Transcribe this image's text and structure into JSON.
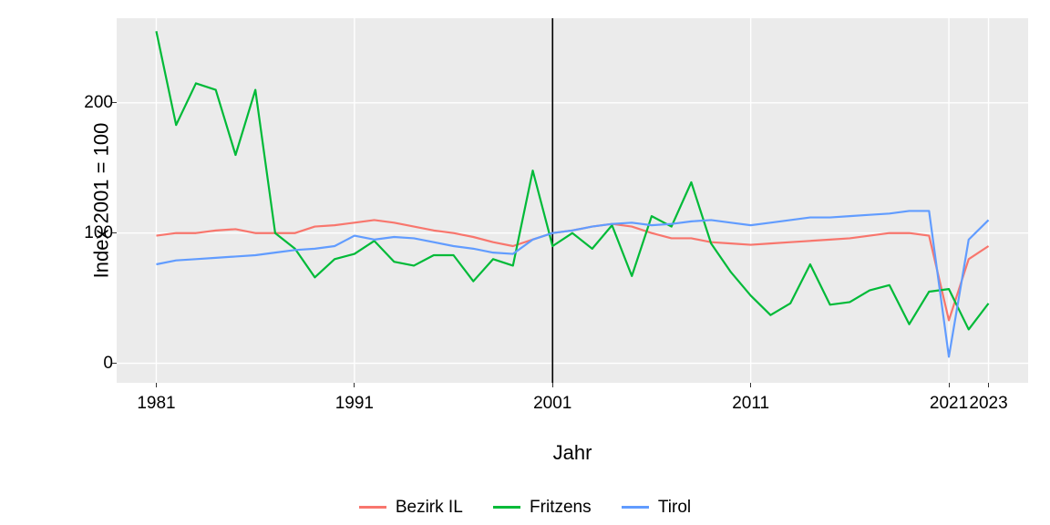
{
  "chart_data": {
    "type": "line",
    "xlabel": "Jahr",
    "ylabel": "Index 2001 = 100",
    "xlim": [
      1979,
      2025
    ],
    "ylim": [
      -15,
      265
    ],
    "x_ticks": [
      1981,
      1991,
      2001,
      2011,
      2021,
      2023
    ],
    "y_ticks": [
      0,
      100,
      200
    ],
    "reference_x": 2001,
    "x": [
      1981,
      1982,
      1983,
      1984,
      1985,
      1986,
      1987,
      1988,
      1989,
      1990,
      1991,
      1992,
      1993,
      1994,
      1995,
      1996,
      1997,
      1998,
      1999,
      2000,
      2001,
      2002,
      2003,
      2004,
      2005,
      2006,
      2007,
      2008,
      2009,
      2010,
      2011,
      2012,
      2013,
      2014,
      2015,
      2016,
      2017,
      2018,
      2019,
      2020,
      2021,
      2022,
      2023
    ],
    "series": [
      {
        "name": "Bezirk IL",
        "color": "#f8766d",
        "values": [
          98,
          100,
          100,
          102,
          103,
          100,
          100,
          100,
          105,
          106,
          108,
          110,
          108,
          105,
          102,
          100,
          97,
          93,
          90,
          95,
          100,
          102,
          105,
          107,
          105,
          100,
          96,
          96,
          93,
          92,
          91,
          92,
          93,
          94,
          95,
          96,
          98,
          100,
          100,
          98,
          33,
          80,
          90
        ]
      },
      {
        "name": "Fritzens",
        "color": "#00ba38",
        "values": [
          255,
          183,
          215,
          210,
          160,
          210,
          100,
          88,
          66,
          80,
          84,
          94,
          78,
          75,
          83,
          83,
          63,
          80,
          75,
          148,
          90,
          100,
          88,
          106,
          67,
          113,
          105,
          139,
          92,
          70,
          52,
          37,
          46,
          76,
          45,
          47,
          56,
          60,
          30,
          55,
          57,
          26,
          46
        ]
      },
      {
        "name": "Tirol",
        "color": "#619cff",
        "values": [
          76,
          79,
          80,
          81,
          82,
          83,
          85,
          87,
          88,
          90,
          98,
          95,
          97,
          96,
          93,
          90,
          88,
          85,
          84,
          95,
          100,
          102,
          105,
          107,
          108,
          106,
          107,
          109,
          110,
          108,
          106,
          108,
          110,
          112,
          112,
          113,
          114,
          115,
          117,
          117,
          5,
          95,
          110
        ]
      }
    ]
  },
  "legend": [
    "Bezirk IL",
    "Fritzens",
    "Tirol"
  ]
}
